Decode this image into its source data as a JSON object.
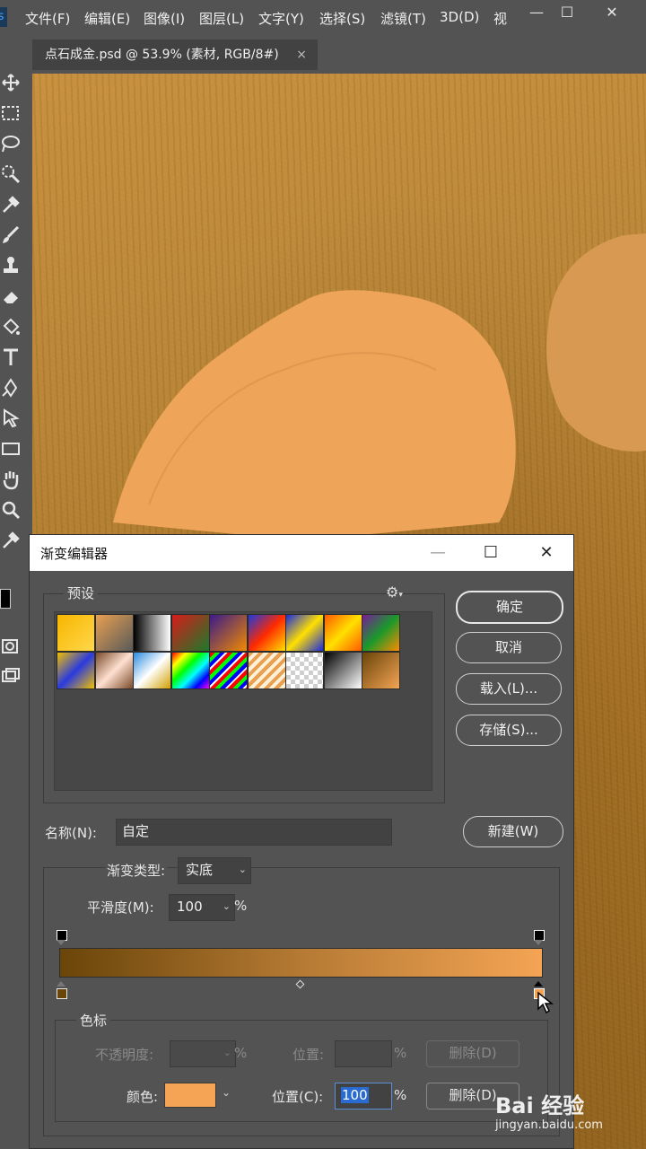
{
  "app": {
    "menu": [
      "文件(F)",
      "编辑(E)",
      "图像(I)",
      "图层(L)",
      "文字(Y)",
      "选择(S)",
      "滤镜(T)",
      "3D(D)",
      "视"
    ],
    "window_controls": [
      "—",
      "☐",
      "✕"
    ],
    "doc_tab": {
      "title": "点石成金.psd @ 53.9% (素材, RGB/8#)",
      "close": "×"
    },
    "tools": [
      "move-icon",
      "marquee-icon",
      "lasso-icon",
      "quick-select-icon",
      "eyedropper-icon",
      "brush-icon",
      "stamp-icon",
      "eraser-icon",
      "paint-bucket-icon",
      "type-icon",
      "pen-icon",
      "path-select-icon",
      "rectangle-icon",
      "hand-icon",
      "zoom-icon",
      "eyedropper-icon"
    ],
    "foreground_color": "#000000",
    "background_color": "#ffffff"
  },
  "dialog": {
    "title": "渐变编辑器",
    "controls": [
      "—",
      "☐",
      "✕"
    ],
    "presets_label": "预设",
    "gear": "⚙",
    "buttons": {
      "ok": "确定",
      "cancel": "取消",
      "load": "载入(L)...",
      "save": "存储(S)...",
      "new": "新建(W)"
    },
    "name_label": "名称(N):",
    "name_value": "自定",
    "gradient_type_label": "渐变类型:",
    "gradient_type_value": "实底",
    "smoothness_label": "平滑度(M):",
    "smoothness_value": "100",
    "percent": "%",
    "stops_group_label": "色标",
    "opacity_label": "不透明度:",
    "opacity_value": "",
    "opacity_position_label": "位置:",
    "opacity_position_value": "",
    "delete_label": "删除(D)",
    "color_label": "颜色:",
    "color_value": "#f4a454",
    "color_position_label": "位置(C):",
    "color_position_value": "100",
    "gradient": {
      "start_color": "#6a4509",
      "end_color": "#f4a454",
      "midpoint": "50%"
    },
    "preset_swatches": [
      "linear-gradient(135deg,#f7b500,#ffd84a)",
      "linear-gradient(135deg,#e8a050,rgba(255,255,255,0.1))",
      "linear-gradient(90deg,#000,#fff)",
      "linear-gradient(135deg,#d81b1b,#1b7a2a)",
      "linear-gradient(135deg,#3a1a8a,#f08a00)",
      "linear-gradient(135deg,#1a3adf,#ff2a00,#ffe000)",
      "linear-gradient(135deg,#1a2adf,#ffe000,#1a2adf)",
      "linear-gradient(135deg,#ff5a00,#ffe000,#ff5a00)",
      "linear-gradient(135deg,#7a1a9a,#1a9a2a,#ff8a00)",
      "linear-gradient(135deg,#f0c000,#2a3adf,#f0c000)",
      "linear-gradient(135deg,#7a4a2a,#ffe0d0,#7a4a2a)",
      "linear-gradient(135deg,#2a8adf,#fff,#d0a000)",
      "linear-gradient(135deg,#ff0000,#ffff00,#00ff00,#00ffff,#0000ff,#ff00ff)",
      "repeating-linear-gradient(135deg,#ff0000 0 4px,#00ff00 4px 8px,#0000ff 8px 12px,#fff 12px 14px)",
      "repeating-linear-gradient(135deg,#e8a050 0 4px,#fff0d8 4px 8px)",
      "repeating-conic-gradient(#cfcfcf 0 25%,#ffffff 0 50%)",
      "linear-gradient(135deg,#000,#fff)",
      "linear-gradient(135deg,#6a4509,#f4a454)"
    ]
  },
  "watermark": {
    "brand": "Bai 经验",
    "url": "jingyan.baidu.com"
  }
}
